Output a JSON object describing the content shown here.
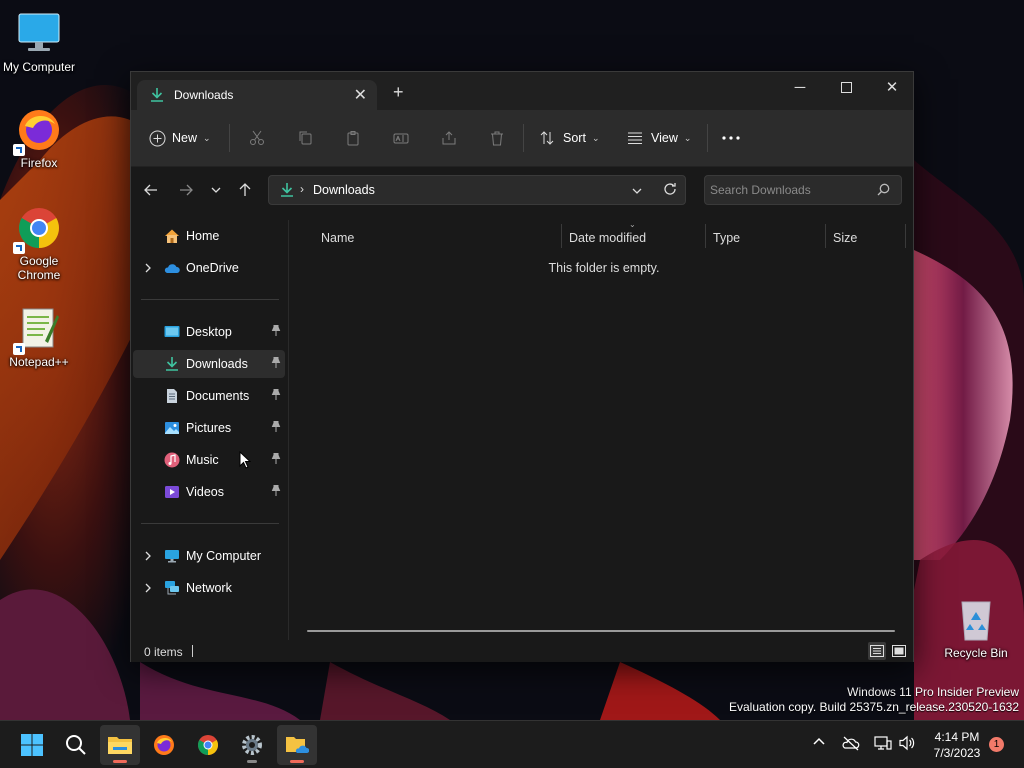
{
  "desktop": {
    "icons": [
      {
        "label": "My Computer"
      },
      {
        "label": "Firefox"
      },
      {
        "label": "Google Chrome"
      },
      {
        "label": "Notepad++"
      }
    ],
    "recycle_bin": "Recycle Bin"
  },
  "window": {
    "tab_title": "Downloads",
    "toolbar": {
      "new_label": "New",
      "sort_label": "Sort",
      "view_label": "View"
    },
    "address": {
      "crumb": "Downloads",
      "search_placeholder": "Search Downloads"
    },
    "nav": {
      "home": "Home",
      "onedrive": "OneDrive",
      "quick_access": [
        {
          "label": "Desktop"
        },
        {
          "label": "Downloads"
        },
        {
          "label": "Documents"
        },
        {
          "label": "Pictures"
        },
        {
          "label": "Music"
        },
        {
          "label": "Videos"
        }
      ],
      "my_computer": "My Computer",
      "network": "Network"
    },
    "columns": {
      "name": "Name",
      "date_modified": "Date modified",
      "type": "Type",
      "size": "Size"
    },
    "empty_message": "This folder is empty.",
    "status": {
      "item_count": "0 items"
    }
  },
  "watermark": {
    "line1": "Windows 11 Pro Insider Preview",
    "line2": "Evaluation copy. Build 25375.zn_release.230520-1632"
  },
  "taskbar": {
    "time": "4:14 PM",
    "date": "7/3/2023",
    "notification_count": "1"
  },
  "colors": {
    "accent_download": "#3fc3a0",
    "taskbar_active": "#f06a5a"
  }
}
